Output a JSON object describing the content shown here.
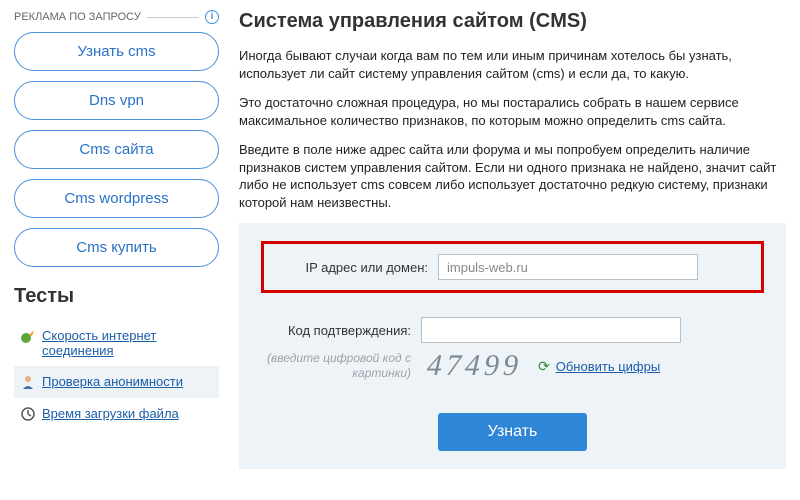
{
  "ads": {
    "header": "РЕКЛАМА ПО ЗАПРОСУ",
    "items": [
      "Узнать cms",
      "Dns vpn",
      "Cms сайта",
      "Cms wordpress",
      "Cms купить"
    ]
  },
  "tests": {
    "title": "Тесты",
    "items": [
      {
        "label": "Скорость интернет соединения"
      },
      {
        "label": "Проверка анонимности"
      },
      {
        "label": "Время загрузки файла"
      }
    ]
  },
  "page": {
    "title": "Система управления сайтом (CMS)",
    "p1": "Иногда бывают случаи когда вам по тем или иным причинам хотелось бы узнать, использует ли сайт систему управления сайтом (cms) и если да, то какую.",
    "p2": "Это достаточно сложная процедура, но мы постарались собрать в нашем сервисе максимальное количество признаков, по которым можно определить cms сайта.",
    "p3": "Введите в поле ниже адрес сайта или форума и мы попробуем определить наличие признаков систем управления сайтом. Если ни одного признака не найдено, значит сайт либо не использует cms совсем либо использует достаточно редкую систему, признаки которой нам неизвестны."
  },
  "form": {
    "ip_label": "IP адрес или домен:",
    "ip_value": "impuls-web.ru",
    "code_label": "Код подтверждения:",
    "code_value": "",
    "hint": "(введите цифровой код с картинки)",
    "captcha": "47499",
    "refresh": "Обновить цифры",
    "submit": "Узнать"
  }
}
